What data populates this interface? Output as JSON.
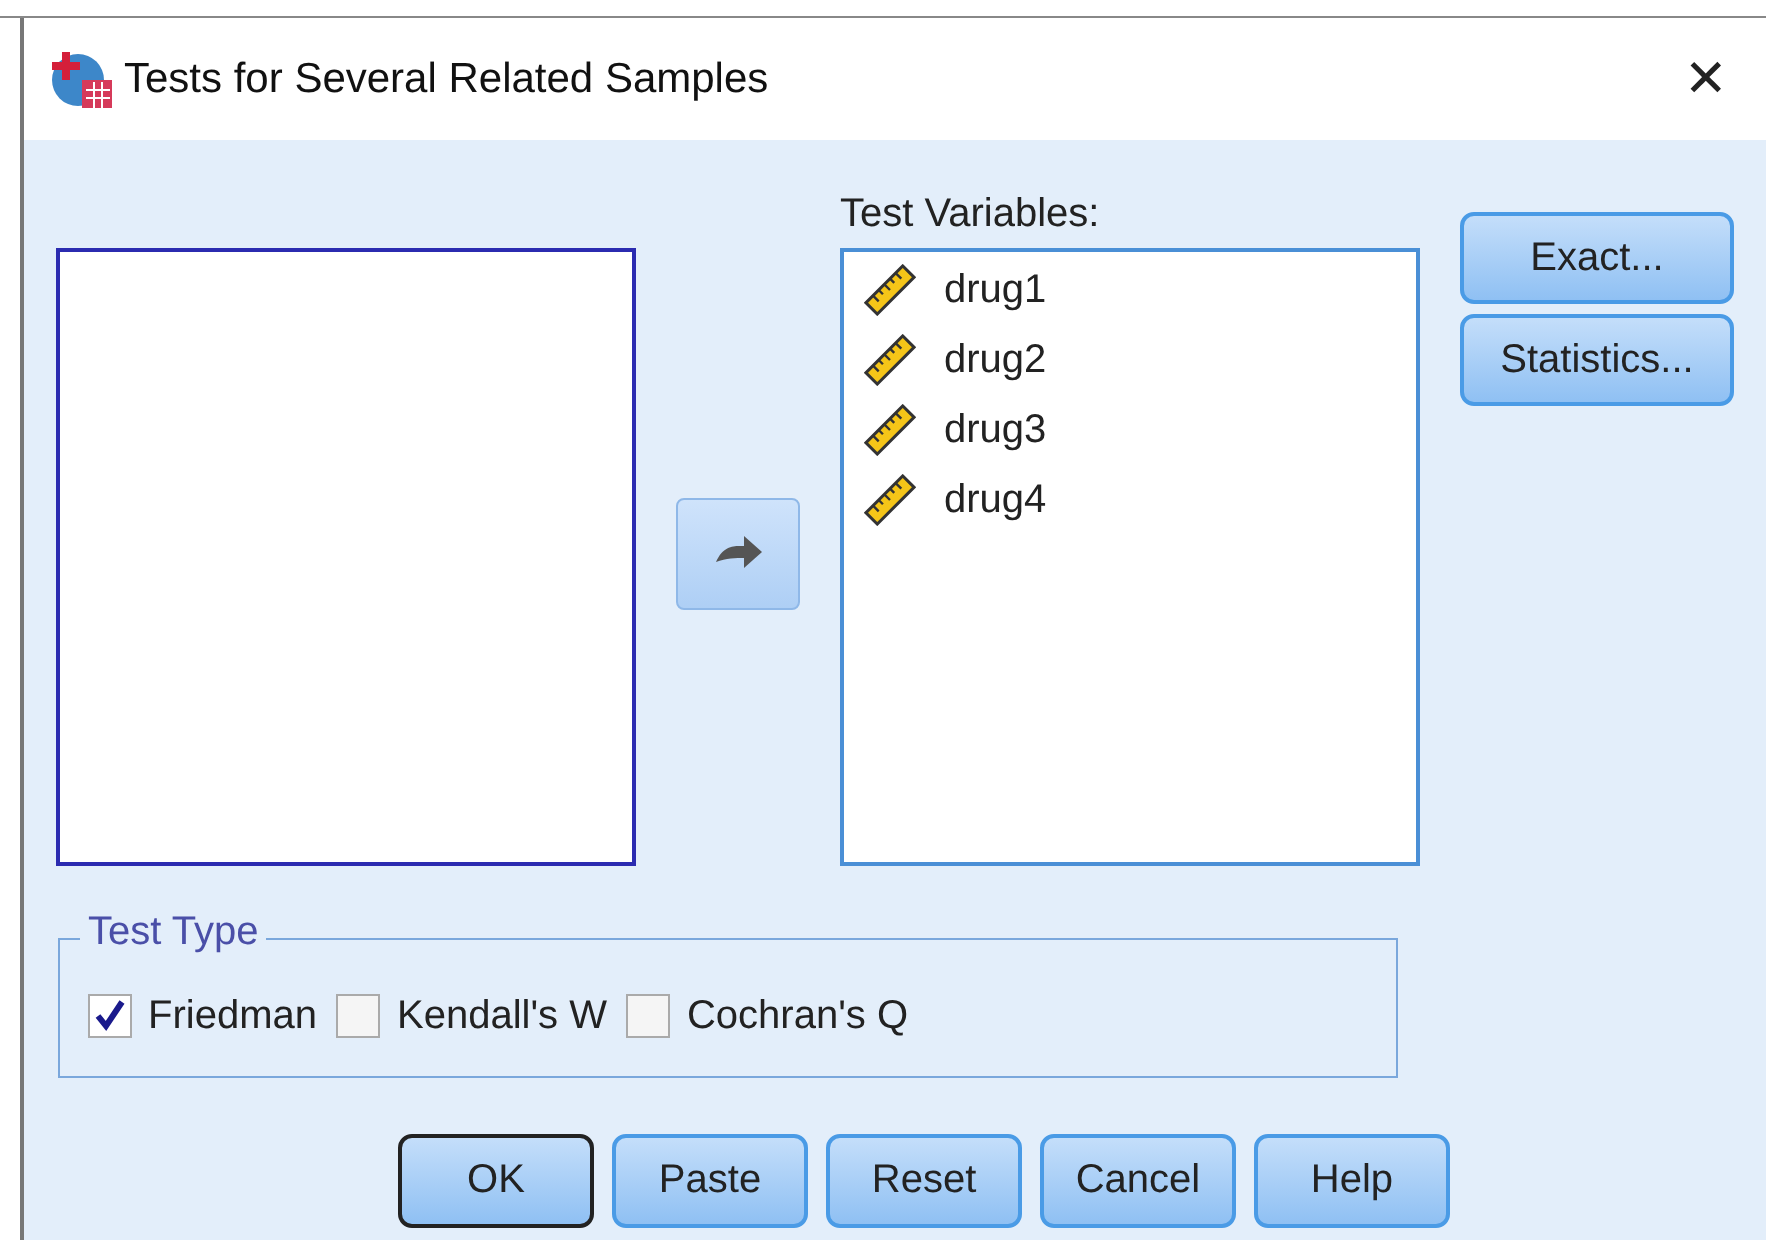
{
  "window": {
    "title": "Tests for Several Related Samples",
    "close": "✕"
  },
  "test_variables": {
    "label": "Test Variables:",
    "items": [
      {
        "name": "drug1"
      },
      {
        "name": "drug2"
      },
      {
        "name": "drug3"
      },
      {
        "name": "drug4"
      }
    ]
  },
  "side_buttons": [
    "Exact...",
    "Statistics..."
  ],
  "test_type": {
    "label": "Test Type",
    "options": [
      {
        "label": "Friedman",
        "checked": true
      },
      {
        "label": "Kendall's W",
        "checked": false
      },
      {
        "label": "Cochran's Q",
        "checked": false
      }
    ]
  },
  "buttons": [
    {
      "label": "OK",
      "default": true
    },
    {
      "label": "Paste",
      "default": false
    },
    {
      "label": "Reset",
      "default": false
    },
    {
      "label": "Cancel",
      "default": false
    },
    {
      "label": "Help",
      "default": false
    }
  ]
}
